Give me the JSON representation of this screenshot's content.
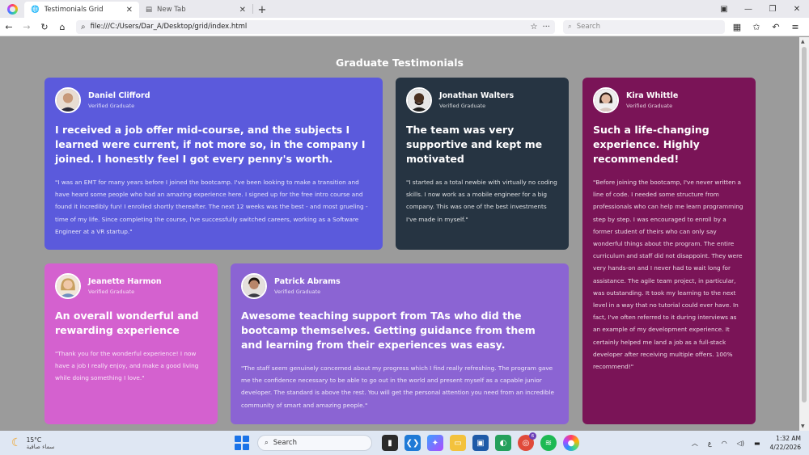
{
  "browser": {
    "tabs": [
      {
        "title": "Testimonials Grid",
        "active": true,
        "icon": "globe-icon"
      },
      {
        "title": "New Tab",
        "active": false,
        "icon": "page-icon"
      }
    ],
    "url": "file:///C:/Users/Dar_A/Desktop/grid/index.html",
    "search_placeholder": "Search"
  },
  "page": {
    "title": "Graduate Testimonials",
    "testimonials": [
      {
        "name": "Daniel Clifford",
        "role": "Verified Graduate",
        "headline": "I received a job offer mid-course, and the subjects I learned were current, if not more so, in the company I joined. I honestly feel I got every penny's worth.",
        "quote": "\"I was an EMT for many years before I joined the bootcamp. I've been looking to make a transition and have heard some people who had an amazing experience here. I signed up for the free intro course and found it incredibly fun! I enrolled shortly thereafter. The next 12 weeks was the best - and most grueling - time of my life. Since completing the course, I've successfully switched careers, working as a Software Engineer at a VR startup.\"",
        "color": "#5b5adc"
      },
      {
        "name": "Jonathan Walters",
        "role": "Verified Graduate",
        "headline": "The team was very supportive and kept me motivated",
        "quote": "\"I started as a total newbie with virtually no coding skills. I now work as a mobile engineer for a big company. This was one of the best investments I've made in myself.\"",
        "color": "#263442"
      },
      {
        "name": "Kira Whittle",
        "role": "Verified Graduate",
        "headline": "Such a life-changing experience. Highly recommended!",
        "quote": "\"Before joining the bootcamp, I've never written a line of code. I needed some structure from professionals who can help me learn programming step by step. I was encouraged to enroll by a former student of theirs who can only say wonderful things about the program. The entire curriculum and staff did not disappoint. They were very hands-on and I never had to wait long for assistance. The agile team project, in particular, was outstanding. It took my learning to the next level in a way that no tutorial could ever have. In fact, I've often referred to it during interviews as an example of my development experience. It certainly helped me land a job as a full-stack developer after receiving multiple offers. 100% recommend!\"",
        "color": "#7a1457"
      },
      {
        "name": "Jeanette Harmon",
        "role": "Verified Graduate",
        "headline": "An overall wonderful and rewarding experience",
        "quote": "\"Thank you for the wonderful experience! I now have a job I really enjoy, and make a good living while doing something I love.\"",
        "color": "#d461cf"
      },
      {
        "name": "Patrick Abrams",
        "role": "Verified Graduate",
        "headline": "Awesome teaching support from TAs who did the bootcamp themselves. Getting guidance from them and learning from their experiences was easy.",
        "quote": "\"The staff seem genuinely concerned about my progress which I find really refreshing. The program gave me the confidence necessary to be able to go out in the world and present myself as a capable junior developer. The standard is above the rest. You will get the personal attention you need from an incredible community of smart and amazing people.\"",
        "color": "#8b64d3"
      }
    ]
  },
  "taskbar": {
    "weather_temp": "15°C",
    "weather_desc": "سماء صافية",
    "search_label": "Search",
    "time": "1:32 AM",
    "date": "4/22/2026",
    "tray_lang": "ع",
    "chrome_badge": "6"
  }
}
